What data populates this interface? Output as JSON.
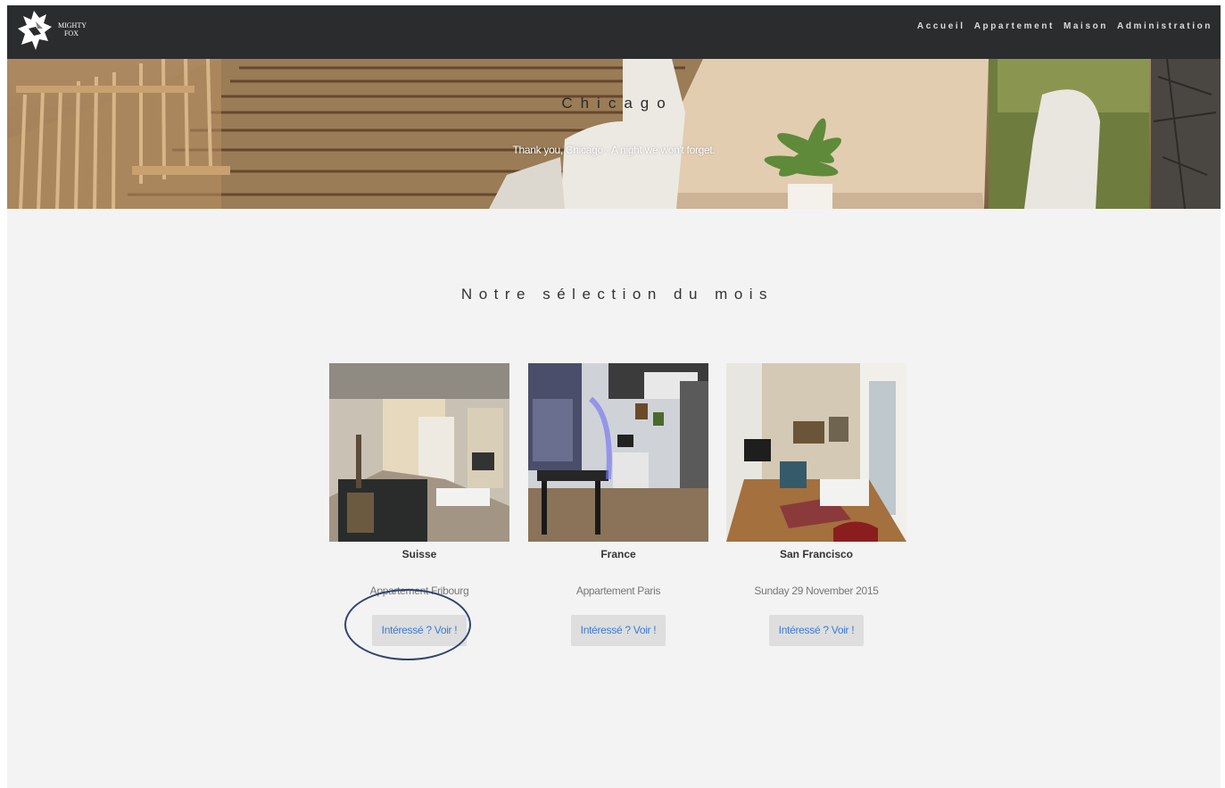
{
  "brand": {
    "line1": "MIGHTY",
    "line2": "FOX",
    "icon": "fox-head-icon"
  },
  "nav": {
    "items": [
      {
        "label": "Accueil"
      },
      {
        "label": "Appartement"
      },
      {
        "label": "Maison"
      },
      {
        "label": "Administration"
      }
    ]
  },
  "hero": {
    "title": "Chicago",
    "subtitle": "Thank you, Chicago - A night we won't forget."
  },
  "section": {
    "title": "Notre sélection du mois",
    "cards": [
      {
        "city": "Suisse",
        "description": "Appartement Fribourg",
        "button": "Intéressé ? Voir !"
      },
      {
        "city": "France",
        "description": "Appartement Paris",
        "button": "Intéressé ? Voir !"
      },
      {
        "city": "San Francisco",
        "description": "Sunday 29 November 2015",
        "button": "Intéressé ? Voir !"
      }
    ]
  },
  "colors": {
    "navbar": "#2b2c2e",
    "page_bg": "#f3f3f3",
    "button_text": "#3a7bd5",
    "button_bg": "#dedede",
    "annotation": "#2d4470"
  }
}
